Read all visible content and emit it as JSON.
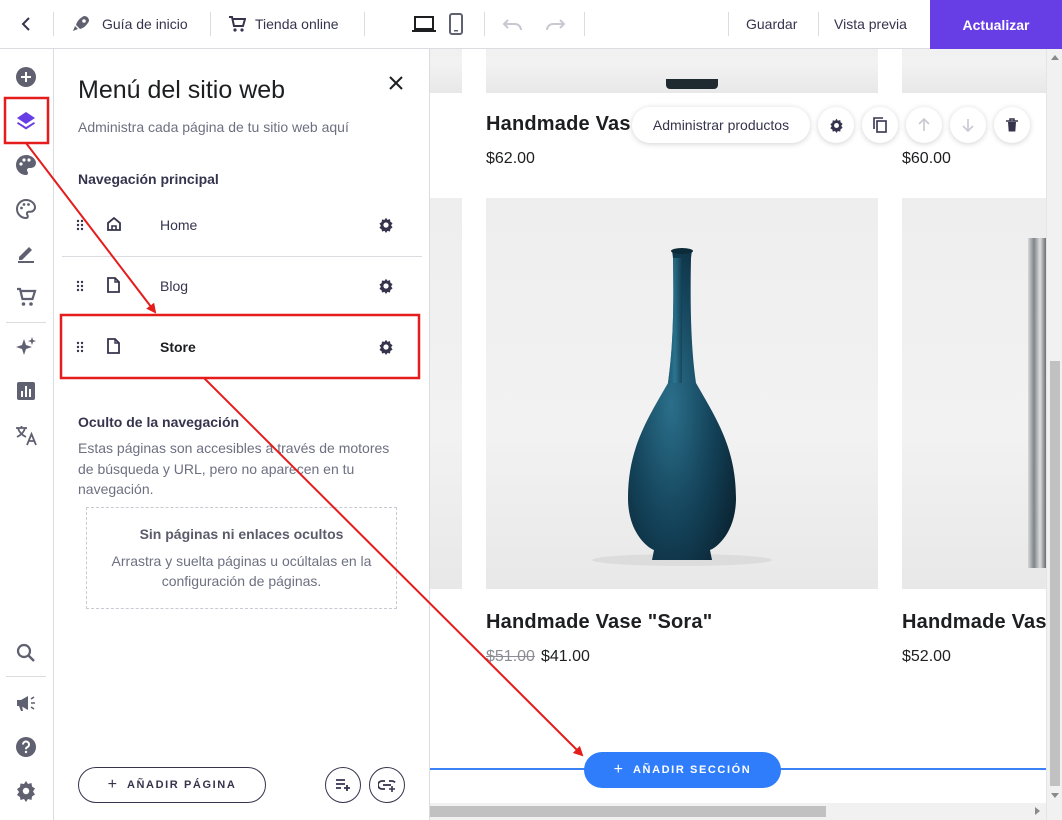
{
  "topbar": {
    "guide_label": "Guía de inicio",
    "store_label": "Tienda online",
    "save_label": "Guardar",
    "preview_label": "Vista previa",
    "update_label": "Actualizar",
    "update_color": "#673de6"
  },
  "rail": {
    "items": [
      "add-element",
      "layers",
      "palette",
      "styles",
      "edit",
      "store",
      "ai-tools",
      "analytics",
      "translate",
      "search",
      "marketing",
      "help",
      "settings"
    ],
    "active_item": "layers"
  },
  "panel": {
    "title": "Menú del sitio web",
    "subtitle": "Administra cada página de tu sitio web aquí",
    "main_nav_heading": "Navegación principal",
    "main_nav_items": [
      {
        "label": "Home",
        "icon": "home-icon"
      },
      {
        "label": "Blog",
        "icon": "page-icon"
      },
      {
        "label": "Store",
        "icon": "page-icon",
        "highlighted": true
      }
    ],
    "hidden_heading": "Oculto de la navegación",
    "hidden_description": "Estas páginas son accesibles a través de motores de búsqueda y URL, pero no aparecen en tu navegación.",
    "empty_title": "Sin páginas ni enlaces ocultos",
    "empty_description": "Arrastra y suelta páginas u ocúltalas en la configuración de páginas.",
    "add_page_label": "AÑADIR PÁGINA"
  },
  "canvas": {
    "manage_products_label": "Administrar productos",
    "products": [
      {
        "title": "Handmade Vas",
        "price": "$62.00"
      },
      {
        "title": "",
        "price": "$60.00"
      },
      {
        "title": "Handmade Vase \"Sora\"",
        "old_price": "$51.00",
        "price": "$41.00"
      },
      {
        "title": "Handmade Vas",
        "price": "$52.00"
      }
    ],
    "add_section_label": "AÑADIR SECCIÓN",
    "add_section_color": "#2f7dfa"
  },
  "annotations": {
    "color": "#e41c1c"
  }
}
